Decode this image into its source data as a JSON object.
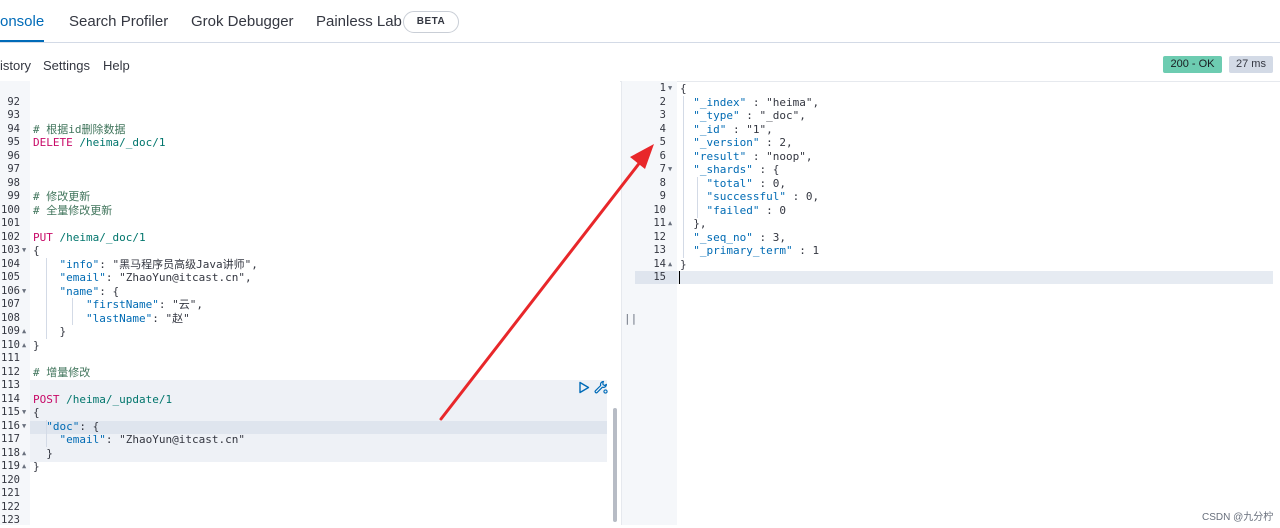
{
  "tabs": [
    {
      "label": "onsole",
      "active": true
    },
    {
      "label": "Search Profiler",
      "active": false
    },
    {
      "label": "Grok Debugger",
      "active": false
    },
    {
      "label": "Painless Lab",
      "active": false
    }
  ],
  "beta_badge": "BETA",
  "toolbar": {
    "history": "istory",
    "settings": "Settings",
    "help": "Help"
  },
  "status": {
    "code": "200 - OK",
    "time": "27 ms",
    "ok_color": "#6dccb1"
  },
  "left_lines": {
    "l92": "92",
    "l93": "93",
    "l94": "94",
    "l95": "95",
    "l96": "96",
    "l97": "97",
    "l98": "98",
    "l99": "99",
    "l100": "100",
    "l101": "101",
    "l102": "102",
    "l103": "103",
    "l104": "104",
    "l105": "105",
    "l106": "106",
    "l107": "107",
    "l108": "108",
    "l109": "109",
    "l110": "110",
    "l111": "111",
    "l112": "112",
    "l113": "113",
    "l114": "114",
    "l115": "115",
    "l116": "116",
    "l117": "117",
    "l118": "118",
    "l119": "119",
    "l120": "120",
    "l121": "121",
    "l122": "122",
    "l123": "123"
  },
  "request": {
    "c94": "# 根据id删除数据",
    "delete_method": "DELETE",
    "delete_url": " /heima/_doc/1",
    "c99": "# 修改更新",
    "c100": "# 全量修改更新",
    "put_method": "PUT",
    "put_url": " /heima/_doc/1",
    "brace_open": "{",
    "info_key": "\"info\"",
    "info_val": "\"黑马程序员高级Java讲师\"",
    "email_key": "\"email\"",
    "email_val": "\"ZhaoYun@itcast.cn\"",
    "name_key": "\"name\"",
    "first_key": "\"firstName\"",
    "first_val": "\"云\"",
    "last_key": "\"lastName\"",
    "last_val": "\"赵\"",
    "c112": "# 增量修改",
    "post_method": "POST",
    "post_url": " /heima/_update/1",
    "doc_key": "\"doc\"",
    "email2_val": "\"ZhaoYun@itcast.cn\""
  },
  "response": {
    "index_key": "\"_index\"",
    "index_val": "\"heima\"",
    "type_key": "\"_type\"",
    "type_val": "\"_doc\"",
    "id_key": "\"_id\"",
    "id_val": "\"1\"",
    "version_key": "\"_version\"",
    "version_val": "2",
    "result_key": "\"result\"",
    "result_val": "\"noop\"",
    "shards_key": "\"_shards\"",
    "total_key": "\"total\"",
    "total_val": "0",
    "successful_key": "\"successful\"",
    "successful_val": "0",
    "failed_key": "\"failed\"",
    "failed_val": "0",
    "seq_key": "\"_seq_no\"",
    "seq_val": "3",
    "primary_key": "\"_primary_term\"",
    "primary_val": "1"
  },
  "right_lines": {
    "r1": "1",
    "r2": "2",
    "r3": "3",
    "r4": "4",
    "r5": "5",
    "r6": "6",
    "r7": "7",
    "r8": "8",
    "r9": "9",
    "r10": "10",
    "r11": "11",
    "r12": "12",
    "r13": "13",
    "r14": "14",
    "r15": "15"
  },
  "watermark": "CSDN @九分柠",
  "icons": {
    "run": "play-icon",
    "wrench": "wrench-icon"
  },
  "arrow_color": "#e8272a"
}
